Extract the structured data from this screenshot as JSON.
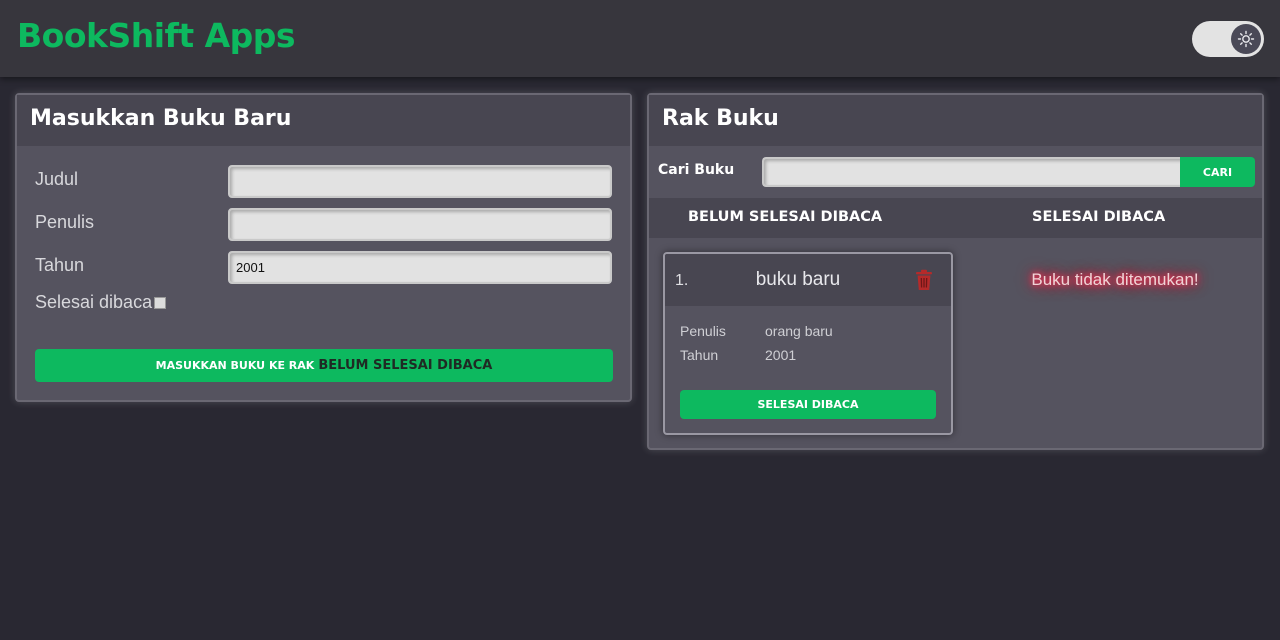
{
  "header": {
    "app_title": "BookShift Apps",
    "theme_icon": "sun-icon"
  },
  "add_form": {
    "title": "Masukkan Buku Baru",
    "fields": {
      "judul_label": "Judul",
      "judul_value": "",
      "penulis_label": "Penulis",
      "penulis_value": "",
      "tahun_label": "Tahun",
      "tahun_value": "2001"
    },
    "selesai_label": "Selesai dibaca",
    "selesai_checked": false,
    "submit_prefix": "MASUKKAN BUKU KE RAK",
    "submit_target": "BELUM SELESAI DIBACA"
  },
  "shelf": {
    "title": "Rak Buku",
    "search_label": "Cari Buku",
    "search_value": "",
    "search_button": "CARI",
    "col_unread": "BELUM SELESAI DIBACA",
    "col_read": "SELESAI DIBACA",
    "unread_books": [
      {
        "number": "1.",
        "title": "buku baru",
        "author_label": "Penulis",
        "author": "orang baru",
        "year_label": "Tahun",
        "year": "2001",
        "action_label": "SELESAI DIBACA"
      }
    ],
    "read_empty_message": "Buku tidak ditemukan!"
  },
  "colors": {
    "accent": "#0db95f",
    "background": "#292832",
    "panel": "#55535f",
    "danger": "#b52a2a"
  }
}
